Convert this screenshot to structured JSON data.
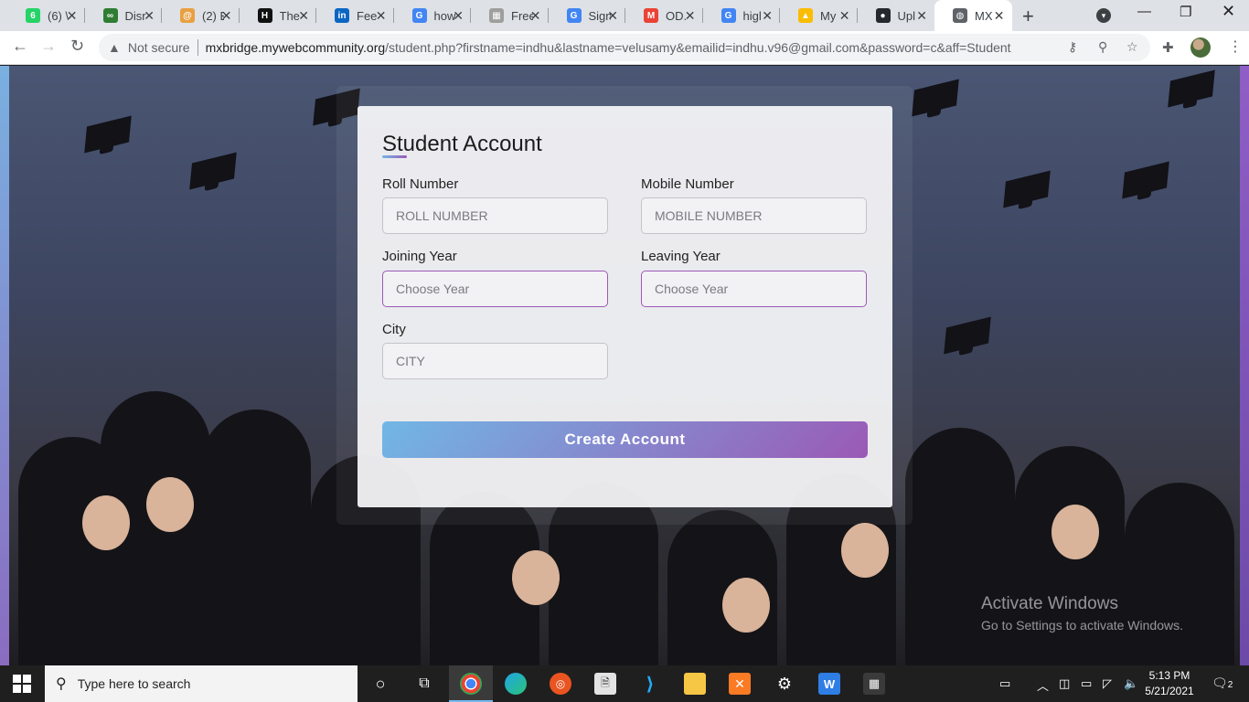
{
  "browser": {
    "tabs": [
      {
        "title": "(6) \\",
        "favicon": "whatsapp-icon",
        "color": "#25d366",
        "glyph": "6"
      },
      {
        "title": "Disr",
        "favicon": "infinity-icon",
        "color": "#2e7d32",
        "glyph": "∞"
      },
      {
        "title": "(2) E",
        "favicon": "swirl-icon",
        "color": "#e8a040",
        "glyph": "@"
      },
      {
        "title": "The",
        "favicon": "hackerearth-icon",
        "color": "#111111",
        "glyph": "H"
      },
      {
        "title": "Fee",
        "favicon": "linkedin-icon",
        "color": "#0a66c2",
        "glyph": "in"
      },
      {
        "title": "how",
        "favicon": "google-icon",
        "color": "#4285f4",
        "glyph": "G"
      },
      {
        "title": "Free",
        "favicon": "image-icon",
        "color": "#9e9e9e",
        "glyph": "▦"
      },
      {
        "title": "Sign",
        "favicon": "google-icon",
        "color": "#4285f4",
        "glyph": "G"
      },
      {
        "title": "OD.",
        "favicon": "gmail-icon",
        "color": "#ea4335",
        "glyph": "M"
      },
      {
        "title": "higl",
        "favicon": "google-icon",
        "color": "#4285f4",
        "glyph": "G"
      },
      {
        "title": "My",
        "favicon": "drive-icon",
        "color": "#fbbc04",
        "glyph": "▲"
      },
      {
        "title": "Upl",
        "favicon": "github-icon",
        "color": "#24292e",
        "glyph": "●"
      },
      {
        "title": "MX",
        "favicon": "globe-icon",
        "color": "#5f6368",
        "glyph": "◍"
      }
    ],
    "active_tab_index": 12,
    "security_label": "Not secure",
    "url_host": "mxbridge.mywebcommunity.org",
    "url_path": "/student.php?firstname=indhu&lastname=velusamy&emailid=indhu.v96@gmail.com&password=c&aff=Student"
  },
  "form": {
    "title": "Student Account",
    "fields": {
      "roll_number": {
        "label": "Roll Number",
        "placeholder": "ROLL NUMBER"
      },
      "mobile_number": {
        "label": "Mobile Number",
        "placeholder": "MOBILE NUMBER"
      },
      "joining_year": {
        "label": "Joining Year",
        "placeholder": "Choose Year"
      },
      "leaving_year": {
        "label": "Leaving Year",
        "placeholder": "Choose Year"
      },
      "city": {
        "label": "City",
        "placeholder": "CITY"
      }
    },
    "submit_label": "Create Account",
    "accent_start": "#71b7e6",
    "accent_end": "#9b59b6"
  },
  "watermark": {
    "line1": "Activate Windows",
    "line2": "Go to Settings to activate Windows."
  },
  "taskbar": {
    "search_placeholder": "Type here to search",
    "apps": [
      "cortana-icon",
      "task-view-icon",
      "chrome-icon",
      "edge-icon",
      "ubuntu-icon",
      "file-icon",
      "vscode-icon",
      "explorer-icon",
      "xampp-icon",
      "settings-icon",
      "wps-icon",
      "calculator-icon"
    ],
    "time": "5:13 PM",
    "date": "5/21/2021",
    "notification_count": "2"
  }
}
